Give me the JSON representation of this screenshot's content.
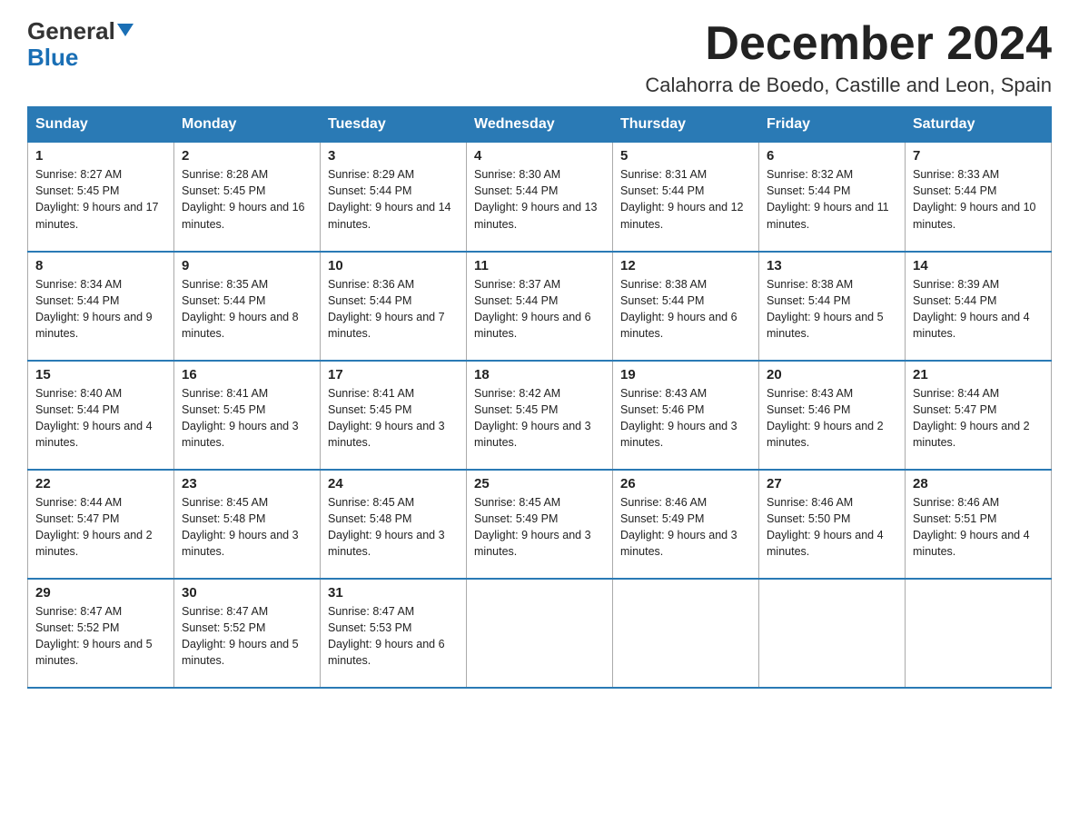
{
  "header": {
    "logo_general": "General",
    "logo_blue": "Blue",
    "month_title": "December 2024",
    "location": "Calahorra de Boedo, Castille and Leon, Spain"
  },
  "weekdays": [
    "Sunday",
    "Monday",
    "Tuesday",
    "Wednesday",
    "Thursday",
    "Friday",
    "Saturday"
  ],
  "weeks": [
    [
      {
        "day": "1",
        "sunrise": "8:27 AM",
        "sunset": "5:45 PM",
        "daylight": "9 hours and 17 minutes."
      },
      {
        "day": "2",
        "sunrise": "8:28 AM",
        "sunset": "5:45 PM",
        "daylight": "9 hours and 16 minutes."
      },
      {
        "day": "3",
        "sunrise": "8:29 AM",
        "sunset": "5:44 PM",
        "daylight": "9 hours and 14 minutes."
      },
      {
        "day": "4",
        "sunrise": "8:30 AM",
        "sunset": "5:44 PM",
        "daylight": "9 hours and 13 minutes."
      },
      {
        "day": "5",
        "sunrise": "8:31 AM",
        "sunset": "5:44 PM",
        "daylight": "9 hours and 12 minutes."
      },
      {
        "day": "6",
        "sunrise": "8:32 AM",
        "sunset": "5:44 PM",
        "daylight": "9 hours and 11 minutes."
      },
      {
        "day": "7",
        "sunrise": "8:33 AM",
        "sunset": "5:44 PM",
        "daylight": "9 hours and 10 minutes."
      }
    ],
    [
      {
        "day": "8",
        "sunrise": "8:34 AM",
        "sunset": "5:44 PM",
        "daylight": "9 hours and 9 minutes."
      },
      {
        "day": "9",
        "sunrise": "8:35 AM",
        "sunset": "5:44 PM",
        "daylight": "9 hours and 8 minutes."
      },
      {
        "day": "10",
        "sunrise": "8:36 AM",
        "sunset": "5:44 PM",
        "daylight": "9 hours and 7 minutes."
      },
      {
        "day": "11",
        "sunrise": "8:37 AM",
        "sunset": "5:44 PM",
        "daylight": "9 hours and 6 minutes."
      },
      {
        "day": "12",
        "sunrise": "8:38 AM",
        "sunset": "5:44 PM",
        "daylight": "9 hours and 6 minutes."
      },
      {
        "day": "13",
        "sunrise": "8:38 AM",
        "sunset": "5:44 PM",
        "daylight": "9 hours and 5 minutes."
      },
      {
        "day": "14",
        "sunrise": "8:39 AM",
        "sunset": "5:44 PM",
        "daylight": "9 hours and 4 minutes."
      }
    ],
    [
      {
        "day": "15",
        "sunrise": "8:40 AM",
        "sunset": "5:44 PM",
        "daylight": "9 hours and 4 minutes."
      },
      {
        "day": "16",
        "sunrise": "8:41 AM",
        "sunset": "5:45 PM",
        "daylight": "9 hours and 3 minutes."
      },
      {
        "day": "17",
        "sunrise": "8:41 AM",
        "sunset": "5:45 PM",
        "daylight": "9 hours and 3 minutes."
      },
      {
        "day": "18",
        "sunrise": "8:42 AM",
        "sunset": "5:45 PM",
        "daylight": "9 hours and 3 minutes."
      },
      {
        "day": "19",
        "sunrise": "8:43 AM",
        "sunset": "5:46 PM",
        "daylight": "9 hours and 3 minutes."
      },
      {
        "day": "20",
        "sunrise": "8:43 AM",
        "sunset": "5:46 PM",
        "daylight": "9 hours and 2 minutes."
      },
      {
        "day": "21",
        "sunrise": "8:44 AM",
        "sunset": "5:47 PM",
        "daylight": "9 hours and 2 minutes."
      }
    ],
    [
      {
        "day": "22",
        "sunrise": "8:44 AM",
        "sunset": "5:47 PM",
        "daylight": "9 hours and 2 minutes."
      },
      {
        "day": "23",
        "sunrise": "8:45 AM",
        "sunset": "5:48 PM",
        "daylight": "9 hours and 3 minutes."
      },
      {
        "day": "24",
        "sunrise": "8:45 AM",
        "sunset": "5:48 PM",
        "daylight": "9 hours and 3 minutes."
      },
      {
        "day": "25",
        "sunrise": "8:45 AM",
        "sunset": "5:49 PM",
        "daylight": "9 hours and 3 minutes."
      },
      {
        "day": "26",
        "sunrise": "8:46 AM",
        "sunset": "5:49 PM",
        "daylight": "9 hours and 3 minutes."
      },
      {
        "day": "27",
        "sunrise": "8:46 AM",
        "sunset": "5:50 PM",
        "daylight": "9 hours and 4 minutes."
      },
      {
        "day": "28",
        "sunrise": "8:46 AM",
        "sunset": "5:51 PM",
        "daylight": "9 hours and 4 minutes."
      }
    ],
    [
      {
        "day": "29",
        "sunrise": "8:47 AM",
        "sunset": "5:52 PM",
        "daylight": "9 hours and 5 minutes."
      },
      {
        "day": "30",
        "sunrise": "8:47 AM",
        "sunset": "5:52 PM",
        "daylight": "9 hours and 5 minutes."
      },
      {
        "day": "31",
        "sunrise": "8:47 AM",
        "sunset": "5:53 PM",
        "daylight": "9 hours and 6 minutes."
      },
      null,
      null,
      null,
      null
    ]
  ]
}
